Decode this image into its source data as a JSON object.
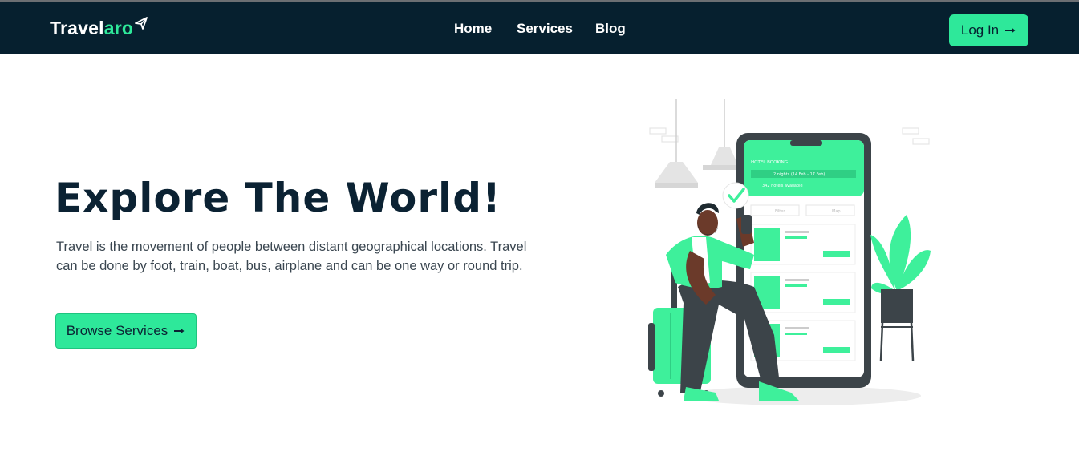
{
  "brand": {
    "part1": "Travel",
    "part2": "aro",
    "icon": "paper-plane-icon"
  },
  "nav": {
    "items": [
      {
        "label": "Home"
      },
      {
        "label": "Services"
      },
      {
        "label": "Blog"
      }
    ]
  },
  "header": {
    "login_label": "Log In",
    "login_icon": "arrow-right-icon"
  },
  "hero": {
    "title": "Explore The World!",
    "description": "Travel is the movement of people between distant geographical locations. Travel can be done by foot, train, boat, bus, airplane and can be one way or round trip.",
    "cta_label": "Browse Services",
    "cta_icon": "arrow-right-icon"
  },
  "illustration": {
    "phone_header": "HOTEL BOOKING",
    "phone_dates": "2 nights (14 Feb - 17 Feb)",
    "phone_available": "342 hotels available",
    "filter_label": "Filter",
    "map_label": "Map"
  },
  "colors": {
    "navbar": "#06202f",
    "accent": "#2ee89a",
    "title": "#0b2233",
    "text": "#3a4650"
  }
}
